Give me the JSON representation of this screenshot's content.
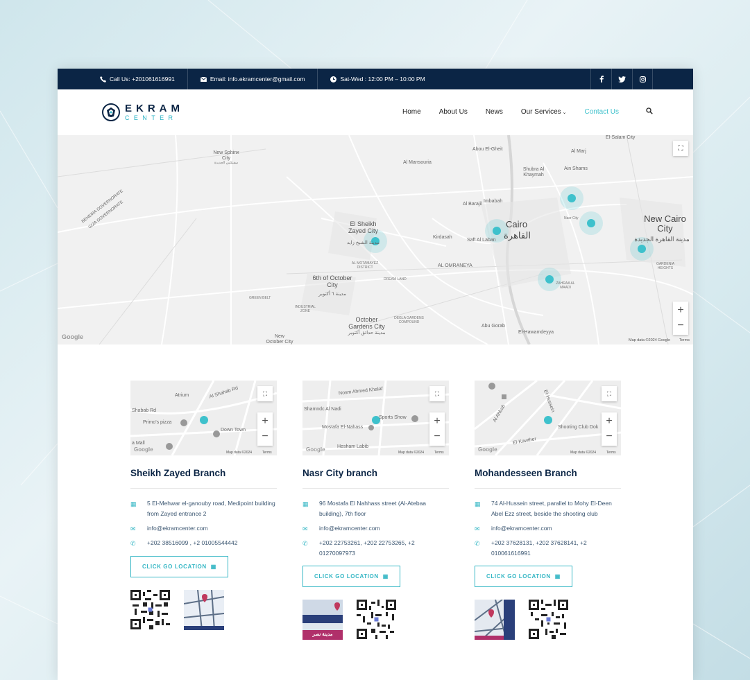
{
  "topbar": {
    "call": "Call Us: +201061616991",
    "email": "Email: info.ekramcenter@gmail.com",
    "hours": "Sat-Wed : 12:00 PM – 10:00 PM",
    "social": [
      "f",
      "t",
      "ig"
    ],
    "icons": [
      "phone-icon",
      "mail-icon",
      "clock-icon",
      "facebook-icon",
      "twitter-icon",
      "instagram-icon"
    ]
  },
  "logo": {
    "line1": "EKRAM",
    "line2": "CENTER"
  },
  "nav": {
    "home": "Home",
    "about": "About Us",
    "news": "News",
    "services": "Our Services",
    "contact": "Contact Us"
  },
  "bigmap": {
    "labels": {
      "new_sphinx": "New Sphinx City",
      "new_sphinx_ar": "سفنكس الجديدة",
      "beheira": "BEHEIRA GOVERNORATE",
      "giza": "GIZA GOVERNORATE",
      "sheikh_zayed": "El Sheikh Zayed City",
      "sheikh_zayed_ar": "مدينة الشيخ زايد",
      "october": "6th of October City",
      "october_ar": "مدينة ٦ أكتوبر",
      "cairo": "Cairo",
      "cairo_ar": "القاهرة",
      "new_cairo": "New Cairo City",
      "new_cairo_ar": "مدينة القاهرة الجديدة",
      "october_gardens": "October Gardens City",
      "october_gardens_ar": "مدينة حدائق أكتوبر",
      "nasr_city": "Nasr City",
      "al_marj": "Al Marj",
      "el_salam": "El-Salam City",
      "shubra": "Shubra Al Khaymah",
      "ain_shams": "Ain Shams",
      "imbabah": "Imbabah",
      "al_omraneya": "AL OMRANEYA",
      "zahraa": "ZAHRAA AL MAADI",
      "kirdasah": "Kirdasah",
      "abu_ghaleb": "Abou El-Gheit",
      "al_mansouria": "Al Mansouria",
      "green_belt": "GREEN BELT",
      "industrial": "INDUSTRIAL ZONE",
      "dream_land": "DREAM LAND",
      "dgc": "DEGLA GARDENS COMPOUND",
      "abu_gorab": "Abu Gorab",
      "hawamdeya": "El-Hawamdeyya",
      "gardenia": "GARDENIA HEIGHTS",
      "new_october": "New October City",
      "al_barajil": "Al Barajil",
      "saft": "Saft Al Laban",
      "metamayez": "AL MOTAMAYEZ DISTRICT"
    },
    "attribution": "Map data ©2024 Google",
    "terms": "Terms",
    "google": "Google"
  },
  "branches": [
    {
      "title": "Sheikh Zayed Branch",
      "address": "5 El-Mehwar el-ganouby road, Medipoint building from Zayed entrance 2",
      "email": "info@ekramcenter.com",
      "phone": "+202 38516099 , +2 01005544442",
      "button": "CLICK GO LOCATION",
      "map": {
        "l1": "Atrium",
        "l2": "Al Shahab Rd",
        "l3": "Primo's pizza",
        "l4": "Down Town",
        "l5": "Shabab Rd",
        "l6": "a Mall",
        "attr": "Map data ©2024",
        "terms": "Terms"
      }
    },
    {
      "title": "Nasr City branch",
      "address": "96 Mostafa El Nahhass street (Al-Atebaa building), 7th floor",
      "email": "info@ekramcenter.com",
      "phone": "+202 22753261, +202 22753265, +2 01270097973",
      "button": "CLICK GO LOCATION",
      "map": {
        "l1": "Nosm Ahmed Khalaf",
        "l2": "Shamndc Al Nadi",
        "l3": "Mostafa El-Nahass",
        "l4": "Sports Show",
        "l5": "Hesham Labib",
        "attr": "Map data ©2024",
        "terms": "Terms"
      },
      "photo_caption": "مدينة نصر"
    },
    {
      "title": "Mohandesseen Branch",
      "address": "74 Al-Hussein street, parallel to Mohy El-Deen Abel Ezz street, beside the shooting club",
      "email": "info@ekramcenter.com",
      "phone": "+202 37628131, +202 37628141, +2 010061616991",
      "button": "CLICK GO LOCATION",
      "map": {
        "l1": "Shooting Club Dok",
        "l2": "El-Kawther",
        "l3": "Al Ahbab",
        "l4": "El-Hussein",
        "attr": "Map data ©2024",
        "terms": "Terms"
      }
    }
  ],
  "colors": {
    "navy": "#0b2545",
    "teal": "#36b7c5",
    "accent": "#3ec1cc"
  }
}
